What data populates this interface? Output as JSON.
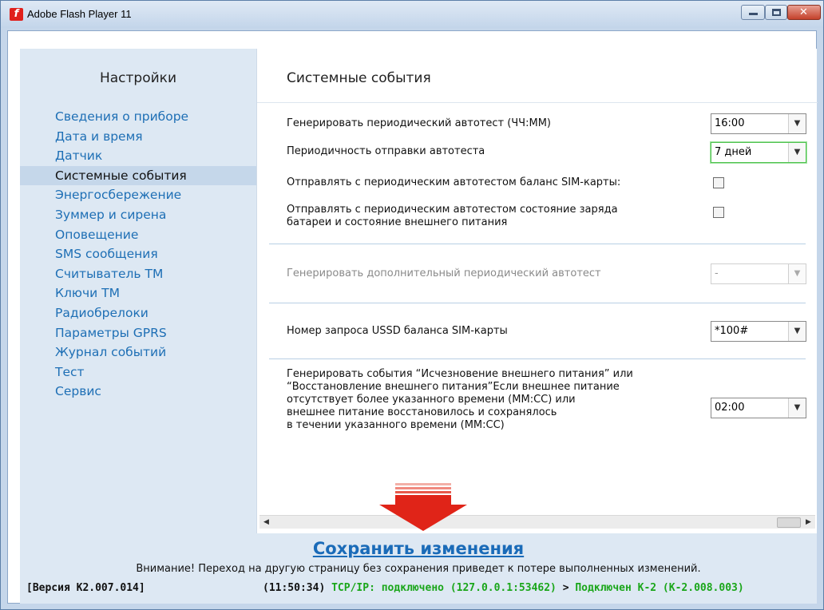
{
  "window": {
    "title": "Adobe Flash Player 11",
    "app_icon_glyph": "f",
    "minimize_glyph": "▁",
    "maximize_glyph": "□",
    "close_glyph": "✕"
  },
  "sidebar": {
    "title": "Настройки",
    "items": [
      {
        "label": "Сведения о приборе",
        "active": false
      },
      {
        "label": "Дата и время",
        "active": false
      },
      {
        "label": "Датчик",
        "active": false
      },
      {
        "label": "Системные события",
        "active": true
      },
      {
        "label": "Энергосбережение",
        "active": false
      },
      {
        "label": "Зуммер и сирена",
        "active": false
      },
      {
        "label": "Оповещение",
        "active": false
      },
      {
        "label": "SMS сообщения",
        "active": false
      },
      {
        "label": "Считыватель ТМ",
        "active": false
      },
      {
        "label": "Ключи ТМ",
        "active": false
      },
      {
        "label": "Радиобрелоки",
        "active": false
      },
      {
        "label": "Параметры GPRS",
        "active": false
      },
      {
        "label": "Журнал событий",
        "active": false
      },
      {
        "label": "Тест",
        "active": false
      },
      {
        "label": "Сервис",
        "active": false
      }
    ]
  },
  "main": {
    "title": "Системные события",
    "rows": {
      "autotest_time": {
        "label": "Генерировать периодический автотест (ЧЧ:ММ)",
        "value": "16:00"
      },
      "autotest_period": {
        "label": "Периодичность отправки автотеста",
        "value": "7 дней"
      },
      "sim_balance": {
        "label": "Отправлять с периодическим автотестом баланс SIM-карты:",
        "checked": false
      },
      "battery_state": {
        "label_line1": "Отправлять  с периодическим автотестом состояние заряда",
        "label_line2": "батареи и состояние внешнего питания",
        "checked": false
      },
      "extra_autotest": {
        "label": "Генерировать дополнительный периодический автотест",
        "value": "-",
        "disabled": true
      },
      "ussd": {
        "label": "Номер запроса USSD баланса SIM-карты",
        "value": "*100#"
      },
      "power_events": {
        "lines": [
          "Генерировать события “Исчезновение внешнего питания” или",
          "“Восстановление внешнего питания”Если внешнее питание",
          "отсутствует более указанного времени (ММ:СС) или",
          "внешнее питание восстановилось и сохранялось",
          "в течении указанного времени (ММ:СС)"
        ],
        "value": "02:00"
      }
    },
    "dropdown_arrow": "▼",
    "scroll_left": "◀",
    "scroll_right": "▶"
  },
  "footer": {
    "save_label": "Сохранить изменения",
    "warning": "Внимание! Переход на другую страницу без сохранения приведет к потере выполненных изменений."
  },
  "statusbar": {
    "version": "[Версия K2.007.014]",
    "time": "(11:50:34)",
    "tcp": "TCP/IP: подключено (127.0.0.1:53462)",
    "separator": ">",
    "connected": "Подключен К-2 (К-2.008.003)"
  },
  "colors": {
    "accent_link": "#1a6bb8",
    "status_green": "#1aa61a",
    "arrow_red": "#e02418",
    "sidebar_bg": "#dde8f3"
  }
}
